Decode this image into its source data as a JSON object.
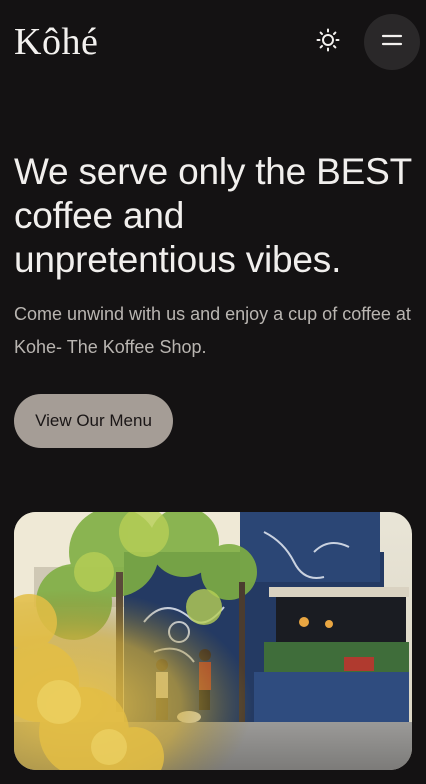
{
  "header": {
    "logo": "Kôhé",
    "theme_toggle_icon": "sun-icon",
    "menu_icon": "menu-icon"
  },
  "hero": {
    "title": "We serve only the BEST coffee and unpretentious vibes.",
    "subtitle": "Come unwind with us and enjoy a cup of coffee at Kohe- The Koffee Shop.",
    "cta_label": "View Our Menu"
  },
  "image": {
    "subject": "storefront-photo"
  },
  "colors": {
    "background": "#141213",
    "text": "#ecebea",
    "muted_text": "#b9b5b1",
    "cta_bg": "#a59d96",
    "menu_button_bg": "#2a2829"
  }
}
